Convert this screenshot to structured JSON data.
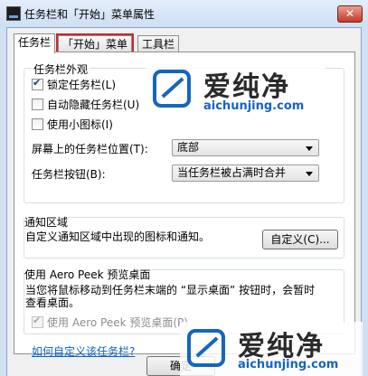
{
  "window": {
    "title": "任务栏和「开始」菜单属性",
    "close_label": "✕"
  },
  "tabs": [
    {
      "label": "任务栏",
      "active": true
    },
    {
      "label": "「开始」菜单",
      "active": false,
      "highlighted": true
    },
    {
      "label": "工具栏",
      "active": false
    }
  ],
  "appearance": {
    "title": "任务栏外观",
    "lock_taskbar": {
      "label": "锁定任务栏(L)",
      "checked": true
    },
    "auto_hide": {
      "label": "自动隐藏任务栏(U)",
      "checked": false
    },
    "small_icons": {
      "label": "使用小图标(I)",
      "checked": false
    },
    "location_label": "屏幕上的任务栏位置(T):",
    "location_value": "底部",
    "buttons_label": "任务栏按钮(B):",
    "buttons_value": "当任务栏被占满时合并"
  },
  "notification": {
    "title": "通知区域",
    "description": "自定义通知区域中出现的图标和通知。",
    "customize_button": "自定义(C)..."
  },
  "aero_peek": {
    "title": "使用 Aero Peek 预览桌面",
    "description_line1": "当您将鼠标移动到任务栏末端的 “显示桌面” 按钮时，会暂时",
    "description_line2": "查看桌面。",
    "checkbox": {
      "label": "使用 Aero Peek 预览桌面(P)",
      "checked": true,
      "disabled": true
    }
  },
  "help_link": "如何自定义该任务栏?",
  "footer": {
    "ok_button": "确定"
  },
  "watermark": {
    "brand_cn": "爱纯净",
    "brand_en": "aichunjing.com"
  }
}
